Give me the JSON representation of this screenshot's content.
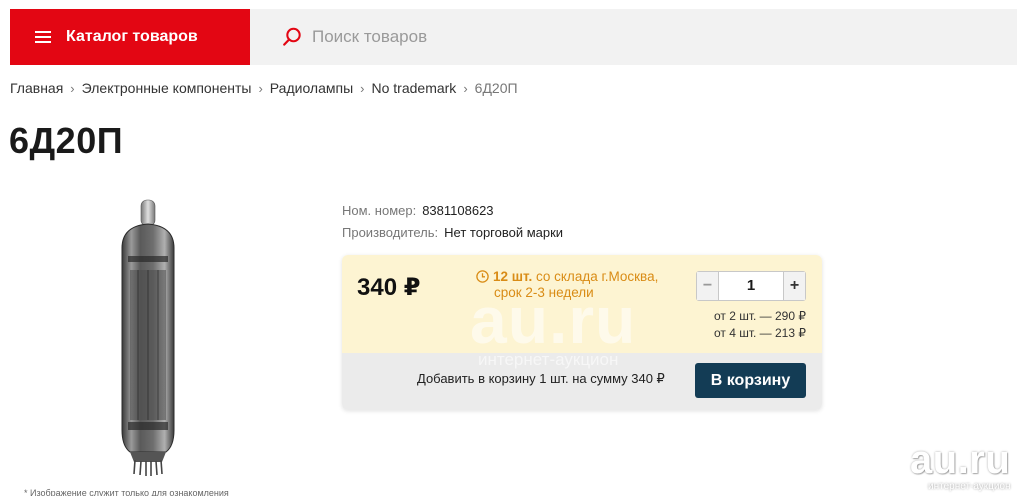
{
  "header": {
    "catalog_label": "Каталог товаров",
    "search_placeholder": "Поиск товаров"
  },
  "breadcrumb": {
    "items": [
      "Главная",
      "Электронные компоненты",
      "Радиолампы",
      "No trademark"
    ],
    "current": "6Д20П"
  },
  "product": {
    "title": "6Д20П",
    "image_note": "* Изображение служит только для ознакомления",
    "meta": {
      "nom_key": "Ном. номер:",
      "nom_val": "8381108623",
      "maker_key": "Производитель:",
      "maker_val": "Нет торговой марки"
    }
  },
  "buy": {
    "price": "340 ₽",
    "stock_qty": "12 шт.",
    "stock_from": "со склада г.Москва,",
    "stock_term": "срок 2-3 недели",
    "quantity": "1",
    "minus": "−",
    "plus": "+",
    "tier1": "от 2 шт. — 290 ₽",
    "tier2": "от 4 шт. — 213 ₽",
    "add_summary": "Добавить в корзину 1 шт. на сумму 340 ₽",
    "cart_button": "В корзину"
  },
  "watermark": {
    "center": "au.ru",
    "center_sub": "интернет-аукцион",
    "corner": "au.ru",
    "corner_sub": "интернет-аукцион"
  },
  "colors": {
    "brand_red": "#e30613",
    "cart_button": "#133c55",
    "stock_orange": "#d98c16",
    "buy_card_top": "#fdf4d2"
  }
}
